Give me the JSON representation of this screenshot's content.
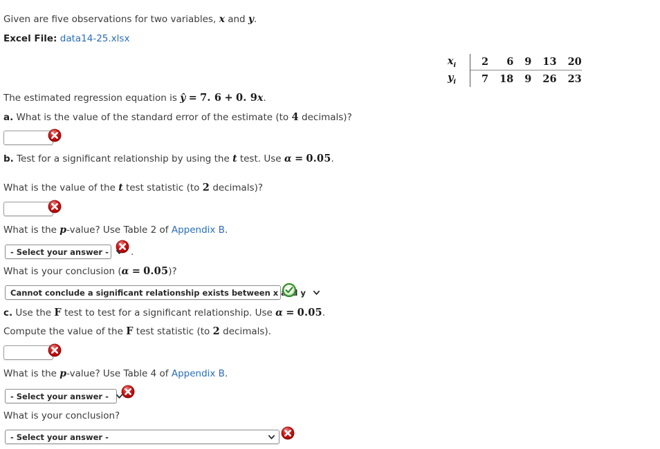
{
  "intro": {
    "line1_pre": "Given are five observations for two variables, ",
    "line1_var1": "x",
    "line1_mid": " and ",
    "line1_var2": "y",
    "line1_end": ".",
    "excel_label": "Excel File:",
    "excel_file": "data14-25.xlsx"
  },
  "table": {
    "x_label": "x",
    "y_label": "y",
    "label_sub": "i",
    "x_values": [
      "2",
      "6",
      "9",
      "13",
      "20"
    ],
    "y_values": [
      "7",
      "18",
      "9",
      "26",
      "23"
    ]
  },
  "regression": {
    "pre": "The estimated regression equation is ",
    "yhat": "ŷ",
    "equals": "=",
    "intercept": "7. 6",
    "plus": "+",
    "slope": "0. 9",
    "xvar": "x",
    "period": "."
  },
  "part_a": {
    "marker": "a.",
    "text_pre": " What is the value of the standard error of the estimate (to ",
    "decimals": "4",
    "text_post": " decimals)?",
    "input_value": "",
    "input_placeholder": "",
    "status": "incorrect"
  },
  "part_b": {
    "marker": "b.",
    "text_pre": " Test for a significant relationship by using the ",
    "t_var": "t",
    "text_mid": " test. Use ",
    "alpha": "α",
    "equals": "=",
    "alpha_value": "0.05",
    "period": ".",
    "t_stat_question_pre": "What is the value of the ",
    "t_stat_var": "t",
    "t_stat_question_mid": " test statistic (to ",
    "t_stat_decimals": "2",
    "t_stat_question_post": " decimals)?",
    "t_stat_value": "",
    "t_stat_status": "incorrect",
    "pvalue_question_pre": "What is the ",
    "pvalue_var": "p",
    "pvalue_question_mid": "-value? Use Table 2 of ",
    "pvalue_link": "Appendix B",
    "pvalue_question_post": ".",
    "pvalue_select": "- Select your answer -",
    "pvalue_status": "incorrect",
    "pvalue_trailing": ".",
    "conclusion_question_pre": "What is your conclusion (",
    "conclusion_alpha": "α",
    "conclusion_equals": "=",
    "conclusion_alpha_value": "0.05",
    "conclusion_question_post": ")?",
    "conclusion_select": "Cannot conclude a significant relationship exists between x and y",
    "conclusion_status": "correct"
  },
  "part_c": {
    "marker": "c.",
    "text_pre": " Use the ",
    "F_var": "F",
    "text_mid": " test to test for a significant relationship. Use ",
    "alpha": "α",
    "equals": "=",
    "alpha_value": "0.05",
    "period": ".",
    "compute_pre": "Compute the value of the ",
    "compute_var": "F",
    "compute_mid": " test statistic (to ",
    "compute_decimals": "2",
    "compute_post": " decimals).",
    "f_stat_value": "",
    "f_stat_status": "incorrect",
    "pvalue_question_pre": "What is the ",
    "pvalue_var": "p",
    "pvalue_question_mid": "-value? Use Table 4 of ",
    "pvalue_link": "Appendix B",
    "pvalue_question_post": ".",
    "pvalue_select": "- Select your answer -",
    "pvalue_status": "incorrect",
    "conclusion_question": "What is your conclusion?",
    "conclusion_select": "- Select your answer -",
    "conclusion_status": "incorrect"
  },
  "colors": {
    "link": "#2b6cb9",
    "error": "#c00000",
    "success": "#1e8a2e",
    "text": "#3b3b3b"
  }
}
